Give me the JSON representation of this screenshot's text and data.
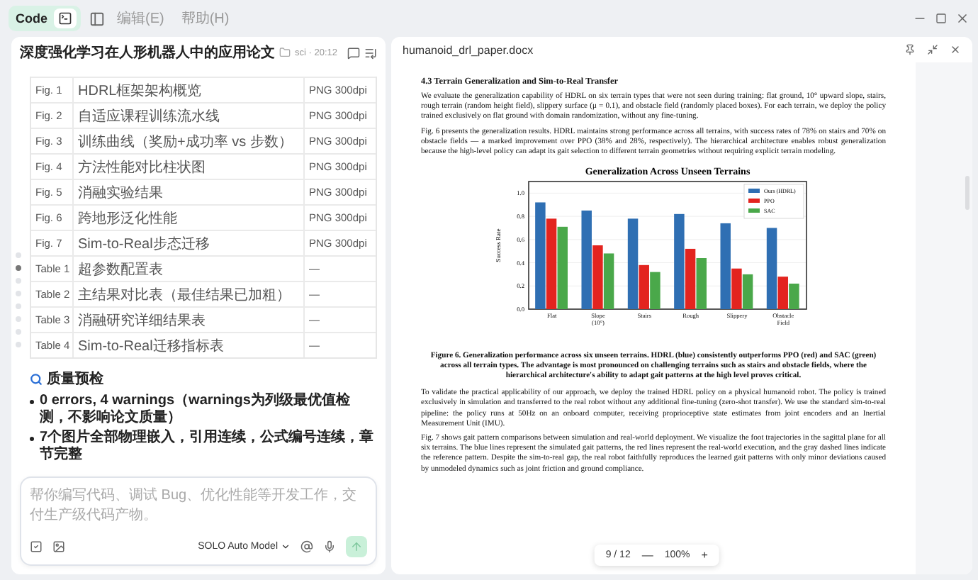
{
  "topbar": {
    "code_label": "Code",
    "menus": [
      {
        "label": "编辑(E)"
      },
      {
        "label": "帮助(H)"
      }
    ]
  },
  "chat": {
    "title": "深度强化学习在人形机器人中的应用论文",
    "meta": "sci · 20:12",
    "table_rows": [
      [
        "Fig. 1",
        "HDRL框架架构概览",
        "PNG 300dpi"
      ],
      [
        "Fig. 2",
        "自适应课程训练流水线",
        "PNG 300dpi"
      ],
      [
        "Fig. 3",
        "训练曲线（奖励+成功率 vs 步数）",
        "PNG 300dpi"
      ],
      [
        "Fig. 4",
        "方法性能对比柱状图",
        "PNG 300dpi"
      ],
      [
        "Fig. 5",
        "消融实验结果",
        "PNG 300dpi"
      ],
      [
        "Fig. 6",
        "跨地形泛化性能",
        "PNG 300dpi"
      ],
      [
        "Fig. 7",
        "Sim-to-Real步态迁移",
        "PNG 300dpi"
      ],
      [
        "Table 1",
        "超参数配置表",
        "—"
      ],
      [
        "Table 2",
        "主结果对比表（最佳结果已加粗）",
        "—"
      ],
      [
        "Table 3",
        "消融研究详细结果表",
        "—"
      ],
      [
        "Table 4",
        "Sim-to-Real迁移指标表",
        "—"
      ]
    ],
    "section_title": "质量预检",
    "bullets": [
      "0 errors, 4 warnings（warnings为列级最优值检测，不影响论文质量）",
      "7个图片全部物理嵌入，引用连续，公式编号连续，章节完整"
    ],
    "nav_dots": [
      {
        "selected": false
      },
      {
        "selected": true
      },
      {
        "selected": false
      },
      {
        "selected": false
      },
      {
        "selected": false
      },
      {
        "selected": false
      },
      {
        "selected": false
      },
      {
        "selected": false
      }
    ],
    "input": {
      "placeholder": "帮你编写代码、调试 Bug、优化性能等开发工作，交付生产级代码产物。"
    },
    "model": "SOLO Auto Model"
  },
  "document": {
    "filename": "humanoid_drl_paper.docx",
    "heading": "4.3 Terrain Generalization and Sim-to-Real Transfer",
    "paragraphs_before": [
      "We evaluate the generalization capability of HDRL on six terrain types that were not seen during training: flat ground, 10° upward slope, stairs, rough terrain (random height field), slippery surface (μ = 0.1), and obstacle field (randomly placed boxes). For each terrain, we deploy the policy trained exclusively on flat ground with domain randomization, without any fine-tuning.",
      "Fig. 6 presents the generalization results. HDRL maintains strong performance across all terrains, with success rates of 78% on stairs and 70% on obstacle fields — a marked improvement over PPO (38% and 28%, respectively). The hierarchical architecture enables robust generalization because the high-level policy can adapt its gait selection to different terrain geometries without requiring explicit terrain modeling."
    ],
    "chart_data": {
      "type": "bar",
      "title": "Generalization Across Unseen Terrains",
      "ylabel": "Success Rate",
      "categories": [
        "Flat",
        "Slope (10°)",
        "Stairs",
        "Rough",
        "Slippery",
        "Obstacle Field"
      ],
      "series": [
        {
          "name": "Ours (HDRL)",
          "color": "#2f6fb3",
          "values": [
            0.92,
            0.85,
            0.78,
            0.82,
            0.74,
            0.7
          ]
        },
        {
          "name": "PPO",
          "color": "#e3241f",
          "values": [
            0.78,
            0.55,
            0.38,
            0.52,
            0.35,
            0.28
          ]
        },
        {
          "name": "SAC",
          "color": "#4aa84a",
          "values": [
            0.71,
            0.48,
            0.32,
            0.44,
            0.3,
            0.22
          ]
        }
      ],
      "ylim": [
        0,
        1.1
      ],
      "yticks": [
        {
          "value": 0,
          "label": "0.0"
        },
        0.2,
        0.4,
        0.6,
        0.8,
        {
          "value": 1,
          "label": "1.0"
        }
      ],
      "grid": true,
      "legend": true
    },
    "caption": "Figure 6. Generalization performance across six unseen terrains. HDRL (blue) consistently outperforms PPO (red) and SAC (green) across all terrain types. The advantage is most pronounced on challenging terrains such as stairs and obstacle fields, where the hierarchical architecture's ability to adapt gait patterns at the high level proves critical.",
    "paragraphs_after": [
      "To validate the practical applicability of our approach, we deploy the trained HDRL policy on a physical humanoid robot. The policy is trained exclusively in simulation and transferred to the real robot without any additional fine-tuning (zero-shot transfer). We use the standard sim-to-real pipeline: the policy runs at 50Hz on an onboard computer, receiving proprioceptive state estimates from joint encoders and an Inertial Measurement Unit (IMU).",
      "Fig. 7 shows gait pattern comparisons between simulation and real-world deployment. We visualize the foot trajectories in the sagittal plane for all six terrains. The blue lines represent the simulated gait patterns, the red lines represent the real-world execution, and the gray dashed lines indicate the reference pattern. Despite the sim-to-real gap, the real robot faithfully reproduces the learned gait patterns with only minor deviations caused by unmodeled dynamics such as joint friction and ground compliance."
    ],
    "page": "9 / 12",
    "zoom_out": "—",
    "zoom": "100%",
    "zoom_in": "+"
  }
}
